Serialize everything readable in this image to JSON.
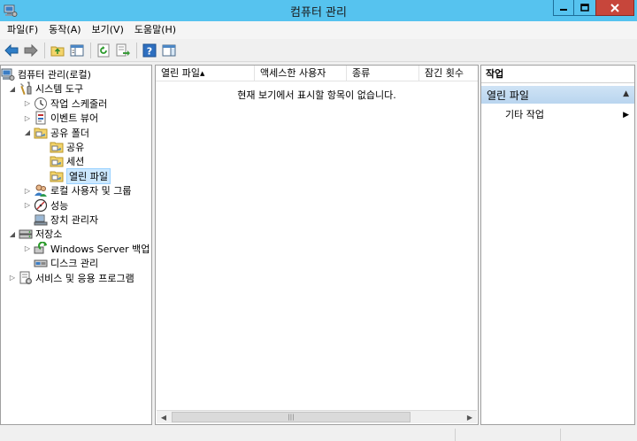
{
  "window": {
    "title": "컴퓨터 관리"
  },
  "menu": [
    "파일(F)",
    "동작(A)",
    "보기(V)",
    "도움말(H)"
  ],
  "toolbar": {
    "buttons": [
      "back-icon",
      "forward-icon",
      "up-folder-icon",
      "show-hide-tree-icon",
      "refresh-icon",
      "export-list-icon",
      "help-icon",
      "show-hide-action-pane-icon"
    ]
  },
  "tree": {
    "items": [
      {
        "label": "컴퓨터 관리(로컬)",
        "icon": "computer-management-icon",
        "toggle": ""
      },
      {
        "label": "시스템 도구",
        "icon": "system-tools-icon",
        "toggle": "expanded"
      },
      {
        "label": "작업 스케줄러",
        "icon": "task-scheduler-icon",
        "toggle": "collapsed"
      },
      {
        "label": "이벤트 뷰어",
        "icon": "event-viewer-icon",
        "toggle": "collapsed"
      },
      {
        "label": "공유 폴더",
        "icon": "shared-folder-icon",
        "toggle": "expanded"
      },
      {
        "label": "공유",
        "icon": "shares-icon",
        "toggle": ""
      },
      {
        "label": "세션",
        "icon": "sessions-icon",
        "toggle": ""
      },
      {
        "label": "열린 파일",
        "icon": "open-files-icon",
        "toggle": "",
        "selected": true
      },
      {
        "label": "로컬 사용자 및 그룹",
        "icon": "local-users-icon",
        "toggle": "collapsed"
      },
      {
        "label": "성능",
        "icon": "performance-icon",
        "toggle": "collapsed"
      },
      {
        "label": "장치 관리자",
        "icon": "device-manager-icon",
        "toggle": ""
      },
      {
        "label": "저장소",
        "icon": "storage-icon",
        "toggle": "expanded"
      },
      {
        "label": "Windows Server 백업",
        "icon": "windows-server-backup-icon",
        "toggle": "collapsed"
      },
      {
        "label": "디스크 관리",
        "icon": "disk-management-icon",
        "toggle": ""
      },
      {
        "label": "서비스 및 응용 프로그램",
        "icon": "services-applications-icon",
        "toggle": "collapsed"
      }
    ]
  },
  "list": {
    "columns": [
      "열린 파일",
      "액세스한 사용자",
      "종류",
      "잠긴 횟수"
    ],
    "sorted_column": "열린 파일",
    "empty_message": "현재 보기에서 표시할 항목이 없습니다."
  },
  "actions": {
    "title": "작업",
    "section_title": "열린 파일",
    "items": [
      "기타 작업"
    ]
  },
  "colors": {
    "titlebar": "#56c3ef",
    "close_button": "#c7463b",
    "selection": "#cce8ff",
    "action_section": "#c4dcf2"
  }
}
